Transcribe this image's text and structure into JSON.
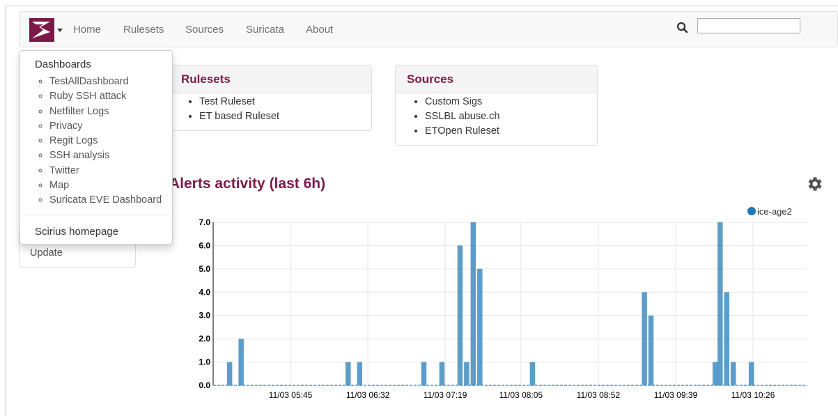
{
  "navbar": {
    "links": [
      "Home",
      "Rulesets",
      "Sources",
      "Suricata",
      "About"
    ],
    "search": {
      "value": "",
      "placeholder": ""
    },
    "icons": {
      "logo": "scirius-logo",
      "dropdown": "caret-down-icon",
      "search": "search-icon"
    },
    "colors": {
      "logo": "#7b1a48",
      "background": "#f8f8f8"
    }
  },
  "dropdown": {
    "title": "Dashboards",
    "items": [
      "TestAllDashboard",
      "Ruby SSH attack",
      "Netfilter Logs",
      "Privacy",
      "Regit Logs",
      "SSH analysis",
      "Twitter",
      "Map",
      "Suricata EVE Dashboard"
    ],
    "footer_link": "Scirius homepage"
  },
  "rulesets_panel": {
    "title": "Rulesets",
    "items": [
      "Test Ruleset",
      "ET based Ruleset"
    ]
  },
  "sources_panel": {
    "title": "Sources",
    "items": [
      "Custom Sigs",
      "SSLBL abuse.ch",
      "ETOpen Ruleset"
    ]
  },
  "side_panel": {
    "update_label": "Update"
  },
  "chart_section": {
    "title": "Alerts activity (last 6h)",
    "settings_icon": "gear-icon"
  },
  "chart_data": {
    "type": "bar",
    "title": "Alerts activity (last 6h)",
    "series": [
      {
        "name": "ice-age2",
        "color": "#1f77b4",
        "points": [
          {
            "x": "11/03 05:08",
            "y": 1
          },
          {
            "x": "11/03 05:15",
            "y": 2
          },
          {
            "x": "11/03 06:20",
            "y": 1
          },
          {
            "x": "11/03 06:27",
            "y": 1
          },
          {
            "x": "11/03 07:06",
            "y": 1
          },
          {
            "x": "11/03 07:17",
            "y": 1
          },
          {
            "x": "11/03 07:28",
            "y": 6
          },
          {
            "x": "11/03 07:32",
            "y": 1
          },
          {
            "x": "11/03 07:36",
            "y": 7
          },
          {
            "x": "11/03 07:40",
            "y": 5
          },
          {
            "x": "11/03 08:12",
            "y": 1
          },
          {
            "x": "11/03 09:20",
            "y": 4
          },
          {
            "x": "11/03 09:24",
            "y": 3
          },
          {
            "x": "11/03 10:03",
            "y": 1
          },
          {
            "x": "11/03 10:06",
            "y": 7
          },
          {
            "x": "11/03 10:10",
            "y": 4
          },
          {
            "x": "11/03 10:14",
            "y": 1
          },
          {
            "x": "11/03 10:25",
            "y": 1
          }
        ]
      }
    ],
    "x_ticks": [
      "11/03 05:45",
      "11/03 06:32",
      "11/03 07:19",
      "11/03 08:05",
      "11/03 08:52",
      "11/03 09:39",
      "11/03 10:26"
    ],
    "y_ticks": [
      "0.0",
      "1.0",
      "2.0",
      "3.0",
      "4.0",
      "5.0",
      "6.0",
      "7.0"
    ],
    "xlim": [
      "11/03 04:58",
      "11/03 10:59"
    ],
    "ylim": [
      0,
      7
    ],
    "grid": true,
    "legend_position": "top-right"
  }
}
